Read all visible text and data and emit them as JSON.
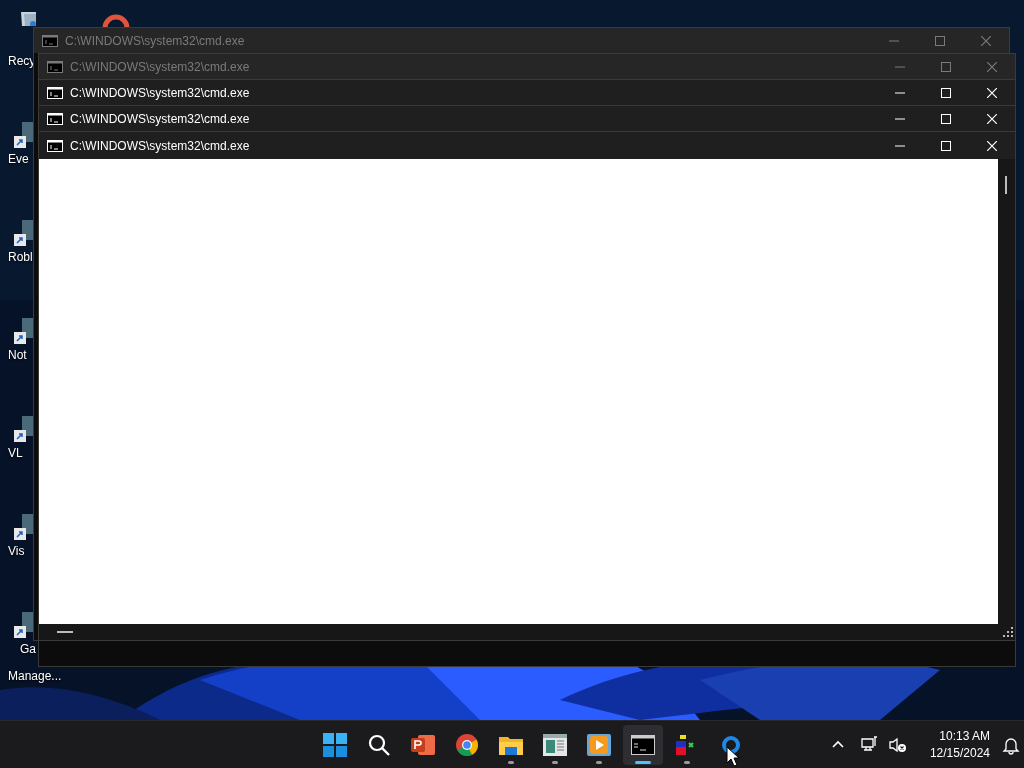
{
  "desktop_icons": [
    {
      "kind": "recycle-bin",
      "label_lines": [
        "Recy"
      ]
    },
    {
      "kind": "shortcut",
      "label_lines": [
        "Eve"
      ]
    },
    {
      "kind": "shortcut",
      "label_lines": [
        "Robl"
      ]
    },
    {
      "kind": "shortcut",
      "label_lines": [
        "Not"
      ]
    },
    {
      "kind": "shortcut",
      "label_lines": [
        "VL"
      ]
    },
    {
      "kind": "shortcut",
      "label_lines": [
        "Vis"
      ]
    },
    {
      "kind": "shortcut",
      "label_lines": [
        "Ga",
        "Manage..."
      ]
    }
  ],
  "windows": [
    {
      "title": "C:\\WINDOWS\\system32\\cmd.exe",
      "active": false
    },
    {
      "title": "C:\\WINDOWS\\system32\\cmd.exe",
      "active": false
    },
    {
      "title": "C:\\WINDOWS\\system32\\cmd.exe",
      "active": true
    },
    {
      "title": "C:\\WINDOWS\\system32\\cmd.exe",
      "active": true
    },
    {
      "title": "C:\\WINDOWS\\system32\\cmd.exe",
      "active": true
    }
  ],
  "taskbar": {
    "apps": [
      {
        "kind": "start",
        "running": false,
        "selected": false
      },
      {
        "kind": "search",
        "running": false,
        "selected": false
      },
      {
        "kind": "slides",
        "running": false,
        "selected": false
      },
      {
        "kind": "browser",
        "running": false,
        "selected": false
      },
      {
        "kind": "folder",
        "running": true,
        "selected": false
      },
      {
        "kind": "sheet",
        "running": true,
        "selected": false
      },
      {
        "kind": "player",
        "running": true,
        "selected": false
      },
      {
        "kind": "terminal",
        "running": true,
        "selected": true
      },
      {
        "kind": "blocks",
        "running": true,
        "selected": false
      },
      {
        "kind": "ring",
        "running": false,
        "selected": false
      }
    ]
  },
  "tray": {
    "time": "10:13 AM",
    "date": "12/15/2024"
  }
}
